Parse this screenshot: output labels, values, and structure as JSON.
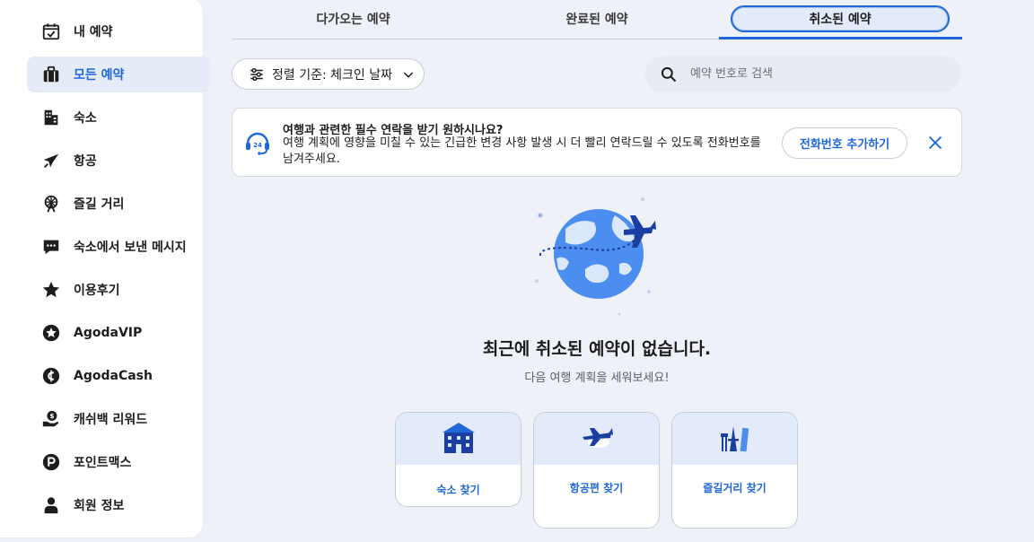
{
  "sidebar": {
    "items": [
      {
        "label": "내 예약",
        "icon": "calendar-check-icon"
      },
      {
        "label": "모든 예약",
        "icon": "briefcase-icon"
      },
      {
        "label": "숙소",
        "icon": "building-icon"
      },
      {
        "label": "항공",
        "icon": "airplane-icon"
      },
      {
        "label": "즐길 거리",
        "icon": "ferris-wheel-icon"
      },
      {
        "label": "숙소에서 보낸 메시지",
        "icon": "chat-icon"
      },
      {
        "label": "이용후기",
        "icon": "star-icon"
      },
      {
        "label": "AgodaVIP",
        "icon": "vip-star-icon"
      },
      {
        "label": "AgodaCash",
        "icon": "cash-icon"
      },
      {
        "label": "캐쉬백 리워드",
        "icon": "cashback-icon"
      },
      {
        "label": "포인트맥스",
        "icon": "pointsmax-icon"
      },
      {
        "label": "회원 정보",
        "icon": "person-icon"
      }
    ],
    "active_index": 1
  },
  "tabs": [
    {
      "label": "다가오는 예약"
    },
    {
      "label": "완료된 예약"
    },
    {
      "label": "취소된 예약"
    }
  ],
  "sort": {
    "label": "정렬 기준: 체크인 날짜"
  },
  "search": {
    "placeholder": "예약 번호로 검색"
  },
  "banner": {
    "title": "여행과 관련한 필수 연락을 받기 원하시나요?",
    "body": "여행 계획에 영향을 미칠 수 있는 긴급한 변경 사항 발생 시 더 빨리 연락드릴 수 있도록 전화번호를 남겨주세요.",
    "button": "전화번호 추가하기",
    "icon_text": "24"
  },
  "empty": {
    "title": "최근에 취소된 예약이 없습니다.",
    "subtitle": "다음 여행 계획을 세워보세요!"
  },
  "cards": [
    {
      "label": "숙소 찾기"
    },
    {
      "label": "항공편 찾기"
    },
    {
      "label": "즐길거리 찾기"
    }
  ],
  "colors": {
    "accent": "#2067da",
    "background": "#eef1f8",
    "active_bg": "#e6ecf7"
  }
}
